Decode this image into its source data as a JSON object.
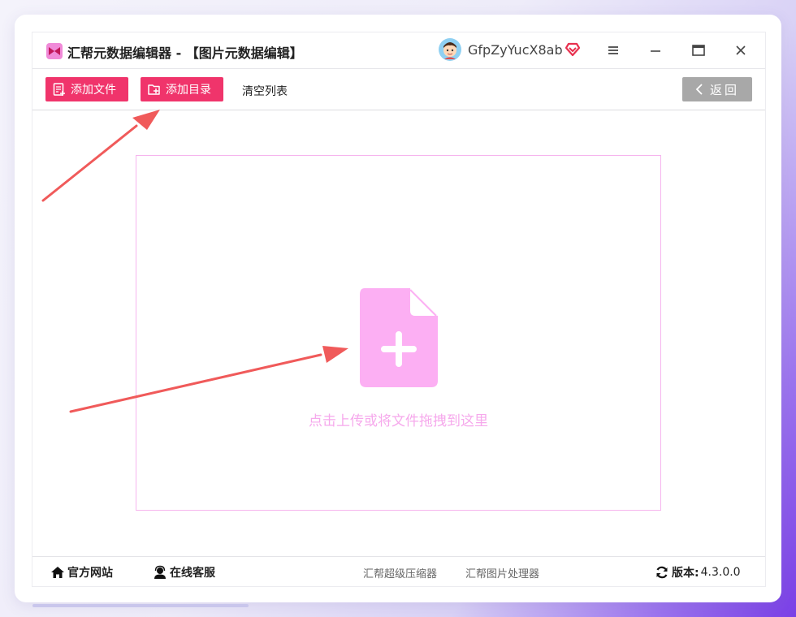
{
  "window": {
    "title": "汇帮元数据编辑器 - 【图片元数据编辑】",
    "username": "GfpZyYucX8ab"
  },
  "toolbar": {
    "add_file_label": "添加文件",
    "add_dir_label": "添加目录",
    "clear_label": "清空列表",
    "back_label": "返回"
  },
  "dropzone": {
    "hint": "点击上传或将文件拖拽到这里"
  },
  "statusbar": {
    "website_label": "官方网站",
    "service_label": "在线客服",
    "link_compress": "汇帮超级压缩器",
    "link_image": "汇帮图片处理器",
    "version_label": "版本:",
    "version_value": "4.3.0.0"
  },
  "colors": {
    "accent_pink": "#f0346b",
    "drop_pink": "#f6a9ec",
    "back_gray": "#a8a8a8",
    "arrow_red": "#f05a5a"
  }
}
